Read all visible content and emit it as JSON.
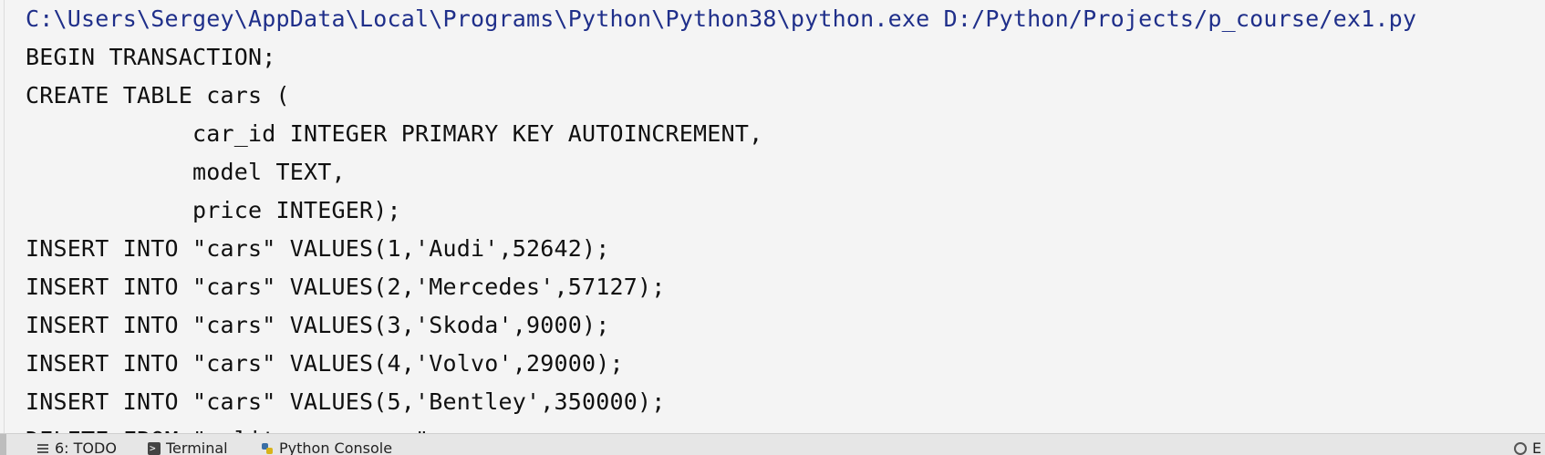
{
  "console": {
    "lines": [
      "C:\\Users\\Sergey\\AppData\\Local\\Programs\\Python\\Python38\\python.exe D:/Python/Projects/p_course/ex1.py",
      "BEGIN TRANSACTION;",
      "CREATE TABLE cars (",
      "            car_id INTEGER PRIMARY KEY AUTOINCREMENT,",
      "            model TEXT,",
      "            price INTEGER);",
      "INSERT INTO \"cars\" VALUES(1,'Audi',52642);",
      "INSERT INTO \"cars\" VALUES(2,'Mercedes',57127);",
      "INSERT INTO \"cars\" VALUES(3,'Skoda',9000);",
      "INSERT INTO \"cars\" VALUES(4,'Volvo',29000);",
      "INSERT INTO \"cars\" VALUES(5,'Bentley',350000);",
      "DELETE FROM \"sqlite_sequence\";"
    ]
  },
  "statusbar": {
    "todo_label": "6: TODO",
    "terminal_label": "Terminal",
    "python_console_label": "Python Console",
    "event_log_label": "E"
  },
  "colors": {
    "command_text": "#1f2f8a",
    "output_text": "#101010",
    "background": "#f4f4f4"
  }
}
